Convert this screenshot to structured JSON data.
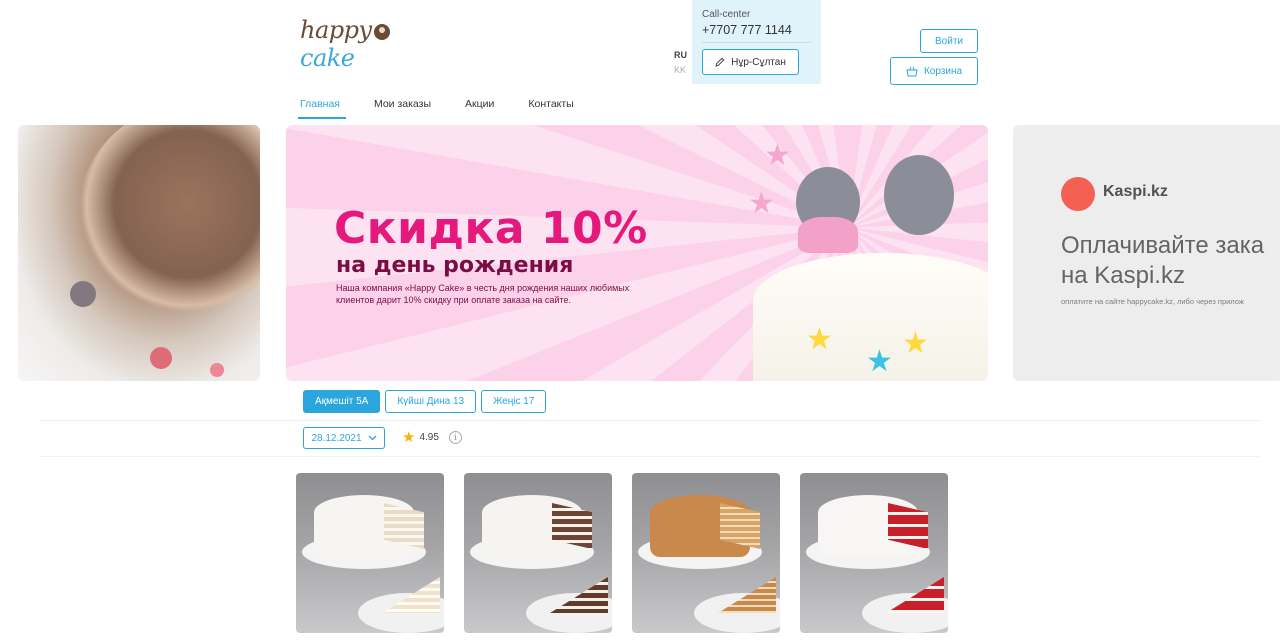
{
  "header": {
    "logo": {
      "part1": "happy",
      "part2": "cake"
    },
    "languages": [
      "RU",
      "KK"
    ],
    "call_center": {
      "label": "Call-center",
      "phone": "+7707 777 1144",
      "city": "Нұр-Сұлтан"
    },
    "login_label": "Войти",
    "cart_label": "Корзина"
  },
  "nav": {
    "items": [
      {
        "label": "Главная",
        "active": true
      },
      {
        "label": "Мои заказы",
        "active": false
      },
      {
        "label": "Акции",
        "active": false
      },
      {
        "label": "Контакты",
        "active": false
      }
    ]
  },
  "carousel": {
    "main": {
      "title": "Скидка 10%",
      "subtitle": "на день рождения",
      "description": "Наша компания «Happy Cake» в честь дня рождения наших любимых клиентов дарит 10% скидку при оплате заказа на сайте."
    },
    "right": {
      "brand": "Kaspi.kz",
      "headline_line1": "Оплачивайте зака",
      "headline_line2": "на Kaspi.kz",
      "small": "оплатите на сайте happycake.kz, либо через прилож"
    }
  },
  "branches": {
    "items": [
      {
        "label": "Ақмешіт 5А",
        "active": true
      },
      {
        "label": "Күйші Дина 13",
        "active": false
      },
      {
        "label": "Жеңіс 17",
        "active": false
      }
    ]
  },
  "filters": {
    "date": "28.12.2021",
    "rating": "4.95",
    "info_glyph": "i"
  },
  "products": [
    {
      "icon": "white-layer-cake",
      "cream": "#f7f5f2",
      "inner": "#e9dcc6",
      "slice": "#efe3cf"
    },
    {
      "icon": "chocolate-layer-cake",
      "cream": "#f6f4f1",
      "inner": "#6b4636",
      "slice": "#5f3b2b"
    },
    {
      "icon": "honey-cake",
      "cream": "#c9884c",
      "inner": "#d9a366",
      "slice": "#c9884c"
    },
    {
      "icon": "red-velvet-cake",
      "cream": "#f7f6f4",
      "inner": "#c8202b",
      "slice": "#c8202b"
    }
  ],
  "colors": {
    "accent": "#2ba6dc",
    "promo_pink": "#e5187c",
    "kaspi_red": "#f14635",
    "callcenter_bg": "#e0f3fb"
  }
}
